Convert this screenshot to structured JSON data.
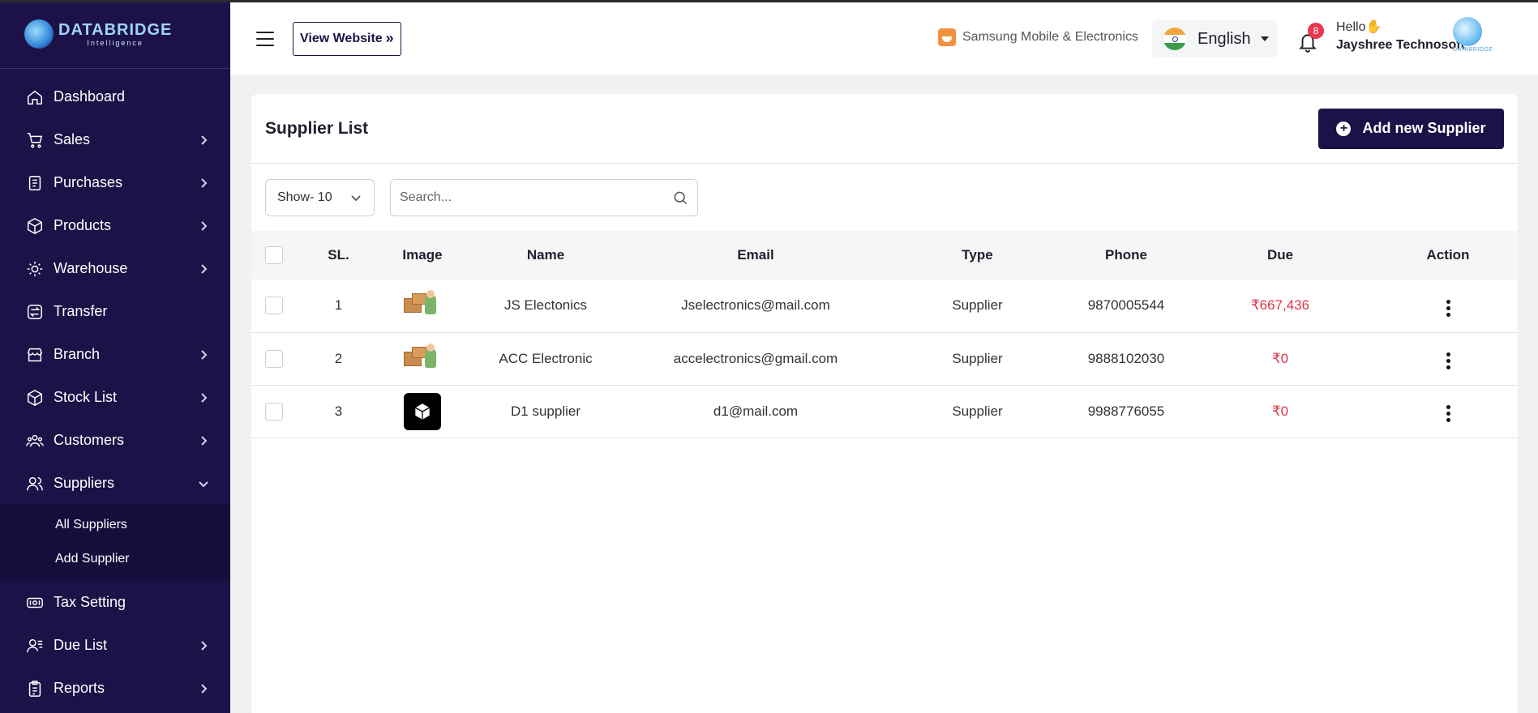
{
  "brand": {
    "title": "DATABRIDGE",
    "subtitle": "Intelligence"
  },
  "sidebar": {
    "items": [
      {
        "label": "Dashboard",
        "icon": "home-icon",
        "has_arrow": false
      },
      {
        "label": "Sales",
        "icon": "cart-icon",
        "has_arrow": true
      },
      {
        "label": "Purchases",
        "icon": "purchase-receipt-icon",
        "has_arrow": true
      },
      {
        "label": "Products",
        "icon": "box-icon",
        "has_arrow": true
      },
      {
        "label": "Warehouse",
        "icon": "warehouse-icon",
        "has_arrow": true
      },
      {
        "label": "Transfer",
        "icon": "transfer-icon",
        "has_arrow": false
      },
      {
        "label": "Branch",
        "icon": "branch-icon",
        "has_arrow": true
      },
      {
        "label": "Stock List",
        "icon": "stock-icon",
        "has_arrow": true
      },
      {
        "label": "Customers",
        "icon": "customers-icon",
        "has_arrow": true
      },
      {
        "label": "Suppliers",
        "icon": "suppliers-icon",
        "has_arrow": true,
        "expanded": true
      },
      {
        "label": "Tax Setting",
        "icon": "tax-icon",
        "has_arrow": false
      },
      {
        "label": "Due List",
        "icon": "due-list-icon",
        "has_arrow": true
      },
      {
        "label": "Reports",
        "icon": "reports-icon",
        "has_arrow": true
      }
    ],
    "suppliers_submenu": [
      "All Suppliers",
      "Add Supplier"
    ]
  },
  "header": {
    "view_website": "View Website",
    "store_name": "Samsung Mobile & Electronics",
    "language": "English",
    "notification_count": "8",
    "greeting": "Hello",
    "greeting_emoji": "✋",
    "user_name": "Jayshree Technosoft",
    "avatar_text": "DATABRIDGE"
  },
  "card": {
    "title": "Supplier List",
    "add_button": "Add new Supplier"
  },
  "toolbar": {
    "show_label": "Show- 10",
    "search_placeholder": "Search..."
  },
  "table": {
    "columns": [
      "SL.",
      "Image",
      "Name",
      "Email",
      "Type",
      "Phone",
      "Due",
      "Action"
    ],
    "rows": [
      {
        "sl": "1",
        "image": "boxes",
        "name": "JS Electonics",
        "email": "Jselectronics@mail.com",
        "type": "Supplier",
        "phone": "9870005544",
        "due": "₹667,436"
      },
      {
        "sl": "2",
        "image": "boxes",
        "name": "ACC Electronic",
        "email": "accelectronics@gmail.com",
        "type": "Supplier",
        "phone": "9888102030",
        "due": "₹0"
      },
      {
        "sl": "3",
        "image": "black-cube",
        "name": "D1 supplier",
        "email": "d1@mail.com",
        "type": "Supplier",
        "phone": "9988776055",
        "due": "₹0"
      }
    ]
  },
  "colors": {
    "sidebar_bg": "#1c1248",
    "accent": "#1c1248",
    "due_red": "#e2344a"
  }
}
